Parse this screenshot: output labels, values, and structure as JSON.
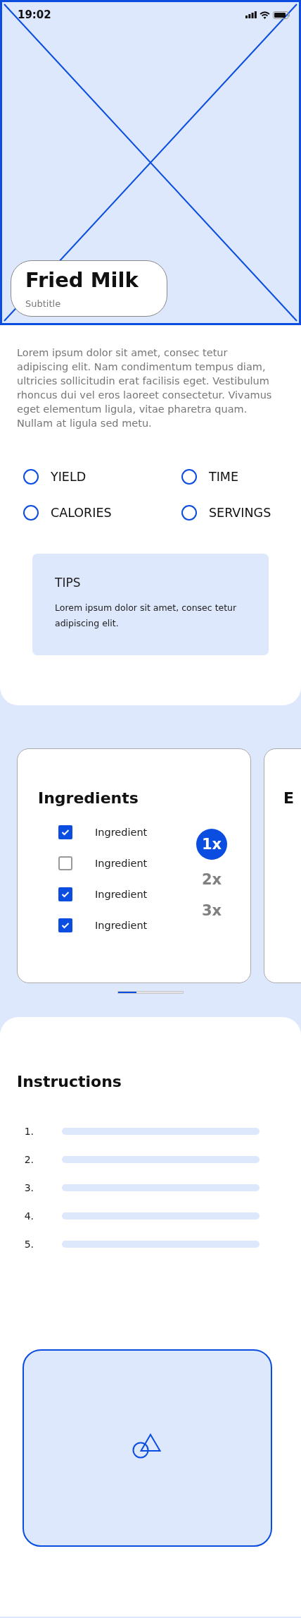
{
  "status_bar": {
    "time": "19:02"
  },
  "title_card": {
    "title": "Fried Milk",
    "subtitle": "Subtitle"
  },
  "description": "Lorem ipsum dolor sit amet, consec tetur adipiscing elit. Nam condimentum tempus diam, ultricies sollicitudin erat facilisis eget. Vestibulum rhoncus dui vel eros laoreet consectetur. Vivamus eget elementum ligula, vitae pharetra quam. Nullam at ligula sed metu.",
  "attributes": [
    {
      "label": "YIELD"
    },
    {
      "label": "TIME"
    },
    {
      "label": "CALORIES"
    },
    {
      "label": "SERVINGS"
    }
  ],
  "tips": {
    "title": "TIPS",
    "text": "Lorem ipsum dolor sit amet, consec tetur adipiscing elit."
  },
  "ingredients_card": {
    "title": "Ingredients",
    "items": [
      {
        "label": "Ingredient",
        "checked": true
      },
      {
        "label": "Ingredient",
        "checked": false
      },
      {
        "label": "Ingredient",
        "checked": true
      },
      {
        "label": "Ingredient",
        "checked": true
      }
    ],
    "multipliers": [
      {
        "label": "1x",
        "selected": true
      },
      {
        "label": "2x",
        "selected": false
      },
      {
        "label": "3x",
        "selected": false
      }
    ]
  },
  "next_card": {
    "title": "E"
  },
  "instructions": {
    "title": "Instructions",
    "steps": [
      "1.",
      "2.",
      "3.",
      "4.",
      "5."
    ]
  }
}
